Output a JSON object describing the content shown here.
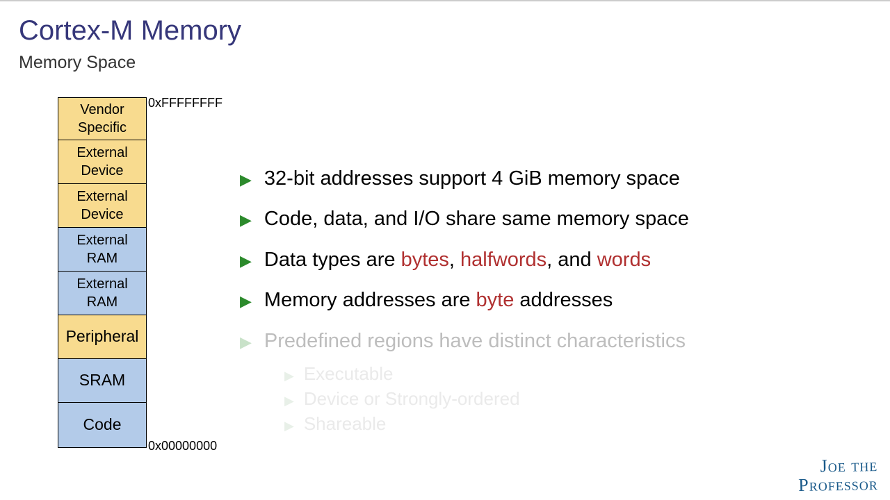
{
  "title": "Cortex-M Memory",
  "subtitle": "Memory Space",
  "addr_top": "0xFFFFFFFF",
  "addr_bottom": "0x00000000",
  "regions": [
    {
      "label1": "Vendor",
      "label2": "Specific",
      "color": "yellow",
      "h": "h-60"
    },
    {
      "label1": "External",
      "label2": "Device",
      "color": "yellow",
      "h": "h-62"
    },
    {
      "label1": "External",
      "label2": "Device",
      "color": "yellow",
      "h": "h-62"
    },
    {
      "label1": "External",
      "label2": "RAM",
      "color": "blue",
      "h": "h-62"
    },
    {
      "label1": "External",
      "label2": "RAM",
      "color": "blue",
      "h": "h-62"
    },
    {
      "label1": "Peripheral",
      "label2": "",
      "color": "yellow",
      "h": "h-64"
    },
    {
      "label1": "SRAM",
      "label2": "",
      "color": "blue",
      "h": "h-64"
    },
    {
      "label1": "Code",
      "label2": "",
      "color": "blue",
      "h": "h-65"
    }
  ],
  "bullets": [
    {
      "pre": "32-bit addresses support 4 GiB memory space",
      "hl": "",
      "post": ""
    },
    {
      "pre": "Code, data, and I/O share same memory space",
      "hl": "",
      "post": ""
    },
    {
      "pre": "Data types are ",
      "hl1": "bytes",
      "mid1": ", ",
      "hl2": "halfwords",
      "mid2": ", and ",
      "hl3": "words",
      "post": ""
    },
    {
      "pre": "Memory addresses are ",
      "hl1": "byte",
      "mid1": " addresses"
    }
  ],
  "bullet_faded": "Predefined regions have distinct characteristics",
  "sub_bullets": [
    "Executable",
    "Device or Strongly-ordered",
    "Shareable"
  ],
  "signature_line1": "Joe the",
  "signature_line2": "Professor"
}
